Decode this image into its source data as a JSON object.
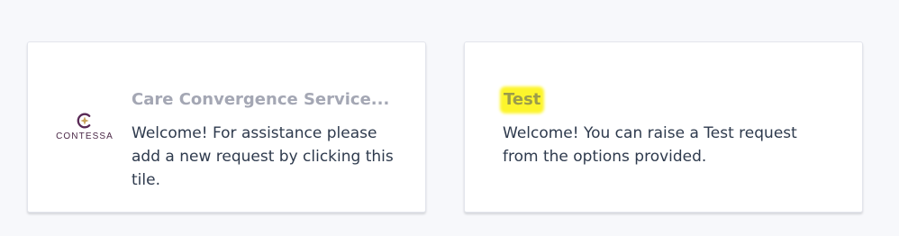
{
  "tiles": [
    {
      "logo": {
        "icon": "contessa-logo-icon",
        "text": "CONTESSA"
      },
      "title": "Care Convergence Service...",
      "description": "Welcome! For assistance please add a new request by clicking this tile."
    },
    {
      "title": "Test",
      "description": "Welcome! You can raise a Test request from the options provided."
    }
  ],
  "colors": {
    "page_background": "#f7f8fb",
    "tile_background": "#ffffff",
    "title": "#a4a7b4",
    "description": "#2e3a4d",
    "highlight": "#fdf52c",
    "logo_purple": "#5a2a56",
    "logo_gold": "#c9a25a"
  }
}
